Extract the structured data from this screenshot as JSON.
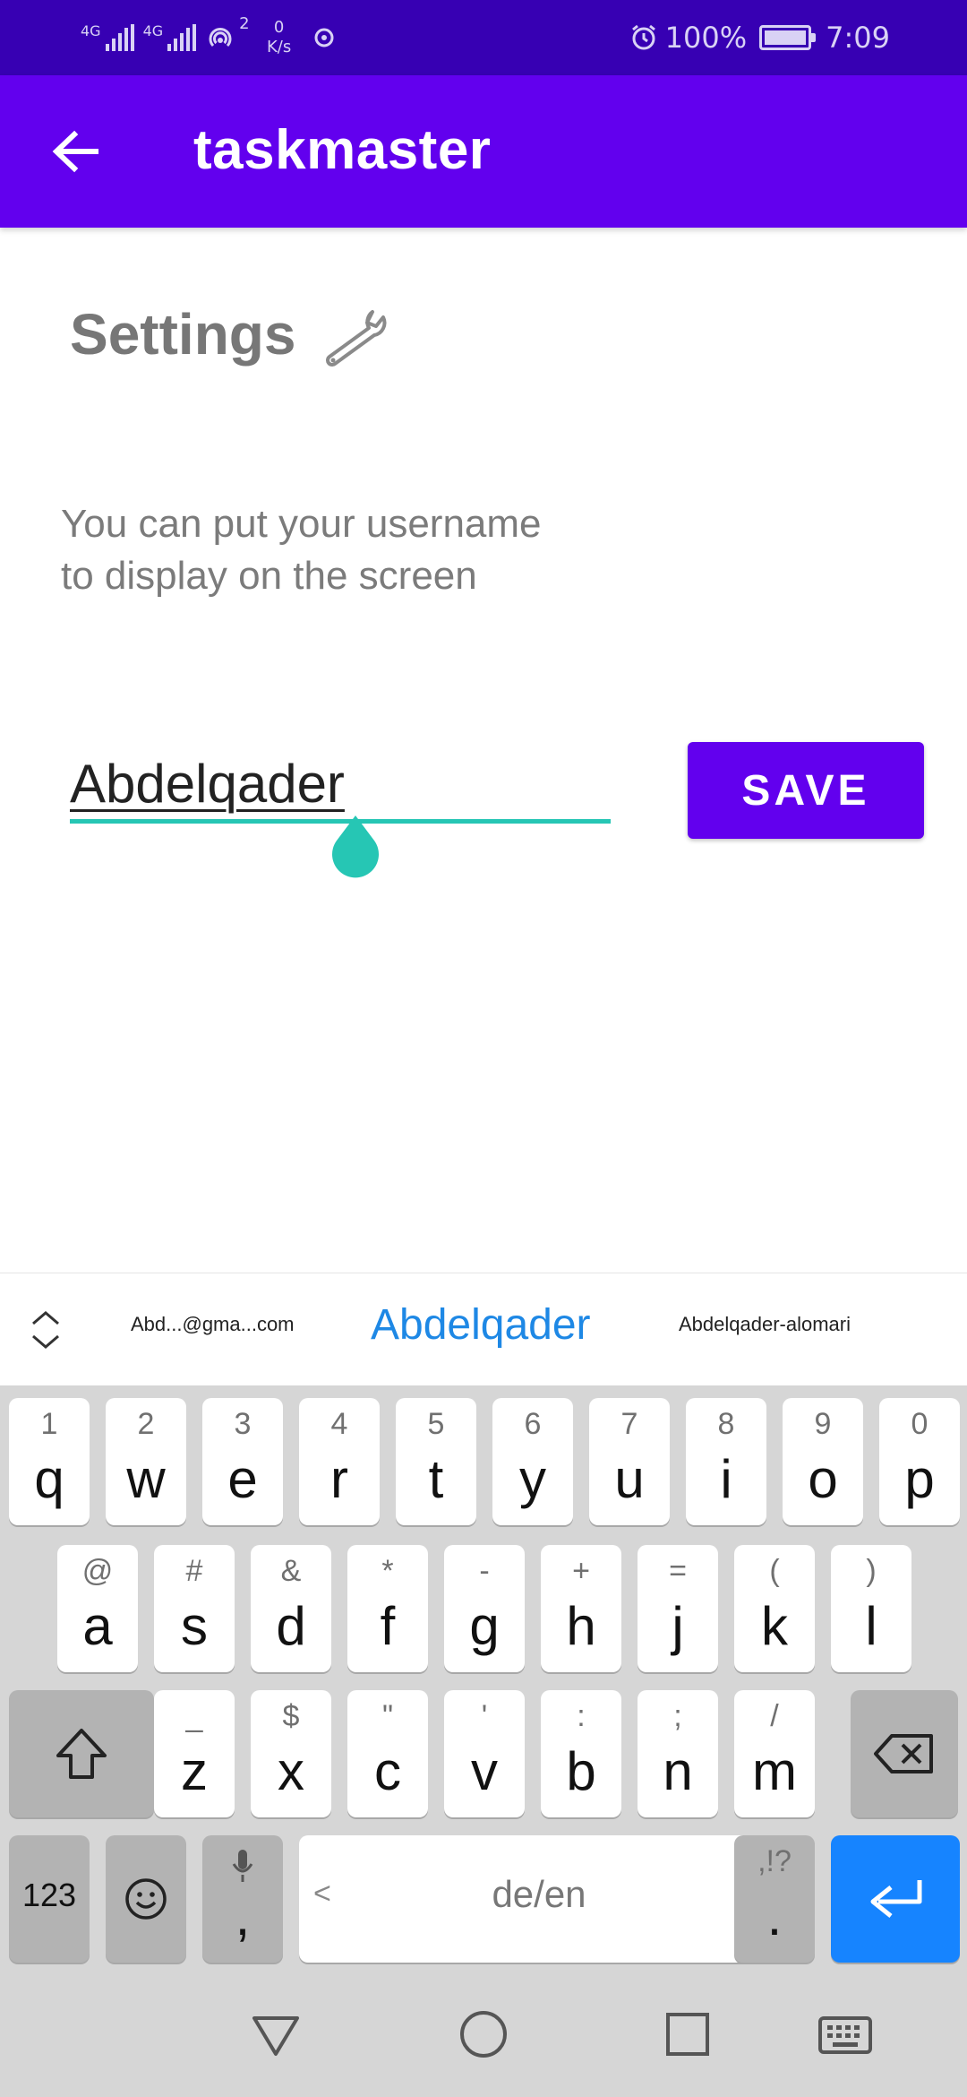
{
  "status_bar": {
    "net1": "4G",
    "net2": "4G",
    "hotspot_count": "2",
    "speed_value": "0",
    "speed_unit": "K/s",
    "battery": "100%",
    "time": "7:09"
  },
  "app_bar": {
    "title": "taskmaster"
  },
  "settings": {
    "title": "Settings",
    "description_line1": "You can put your username",
    "description_line2": "to display on the screen",
    "username_value": "Abdelqader",
    "save_label": "SAVE"
  },
  "keyboard": {
    "suggestions": [
      "Abd...@gma...com",
      "Abdelqader",
      "Abdelqader-alomari"
    ],
    "row1": [
      {
        "alt": "1",
        "key": "q"
      },
      {
        "alt": "2",
        "key": "w"
      },
      {
        "alt": "3",
        "key": "e"
      },
      {
        "alt": "4",
        "key": "r"
      },
      {
        "alt": "5",
        "key": "t"
      },
      {
        "alt": "6",
        "key": "y"
      },
      {
        "alt": "7",
        "key": "u"
      },
      {
        "alt": "8",
        "key": "i"
      },
      {
        "alt": "9",
        "key": "o"
      },
      {
        "alt": "0",
        "key": "p"
      }
    ],
    "row2": [
      {
        "alt": "@",
        "key": "a"
      },
      {
        "alt": "#",
        "key": "s"
      },
      {
        "alt": "&",
        "key": "d"
      },
      {
        "alt": "*",
        "key": "f"
      },
      {
        "alt": "-",
        "key": "g"
      },
      {
        "alt": "+",
        "key": "h"
      },
      {
        "alt": "=",
        "key": "j"
      },
      {
        "alt": "(",
        "key": "k"
      },
      {
        "alt": ")",
        "key": "l"
      }
    ],
    "row3": [
      {
        "alt": "_",
        "key": "z"
      },
      {
        "alt": "$",
        "key": "x"
      },
      {
        "alt": "\"",
        "key": "c"
      },
      {
        "alt": "'",
        "key": "v"
      },
      {
        "alt": ":",
        "key": "b"
      },
      {
        "alt": ";",
        "key": "n"
      },
      {
        "alt": "/",
        "key": "m"
      }
    ],
    "numbers_label": "123",
    "comma_key": ",",
    "space_label": "de/en",
    "space_left_arrow": "<",
    "space_right_arrow": ">",
    "period_alt": ",!?",
    "period_key": "."
  },
  "icons": {
    "back": "arrow-left-icon",
    "settings": "wrench-icon",
    "alarm": "alarm-icon",
    "shift": "shift-icon",
    "backspace": "backspace-icon",
    "emoji": "emoji-icon",
    "mic": "mic-icon",
    "enter": "enter-icon"
  },
  "colors": {
    "status_bar": "#3700b3",
    "primary": "#6200ee",
    "accent": "#26c6b4",
    "suggestion_highlight": "#1e88e5",
    "enter_key": "#1684ff"
  }
}
